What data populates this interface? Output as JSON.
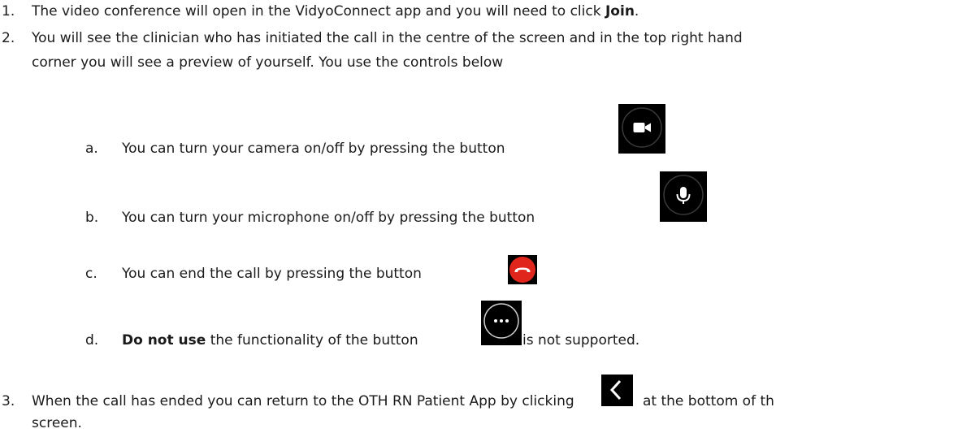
{
  "items": [
    {
      "number": "1.",
      "text_before": "The video conference will open in the VidyoConnect app and you will need to click ",
      "bold": "Join",
      "text_after": "."
    },
    {
      "number": "2.",
      "line1": "You will see the clinician who has initiated the call in the centre of the screen and in the top right hand",
      "line2": "corner you will see a preview of yourself. You use the controls below"
    },
    {
      "number": "3.",
      "text_before": "When the call has ended you can return to the OTH RN Patient App by clicking",
      "text_after": "at the bottom of th",
      "line2": "screen."
    }
  ],
  "subitems": [
    {
      "letter": "a.",
      "text": "You can turn your camera on/off by pressing the button",
      "icon": "camera-icon"
    },
    {
      "letter": "b.",
      "text": "You can turn your microphone on/off by pressing the button",
      "icon": "microphone-icon"
    },
    {
      "letter": "c.",
      "text": "You can end the call by pressing the button",
      "icon": "end-call-icon"
    },
    {
      "letter": "d.",
      "bold": "Do not use",
      "text": " the functionality of the button",
      "text_after": "is not supported.",
      "icon": "more-options-icon"
    }
  ],
  "colors": {
    "text": "#1a1a1a",
    "button_bg": "#000000",
    "end_call_red": "#e0261c",
    "icon_white": "#ffffff"
  }
}
